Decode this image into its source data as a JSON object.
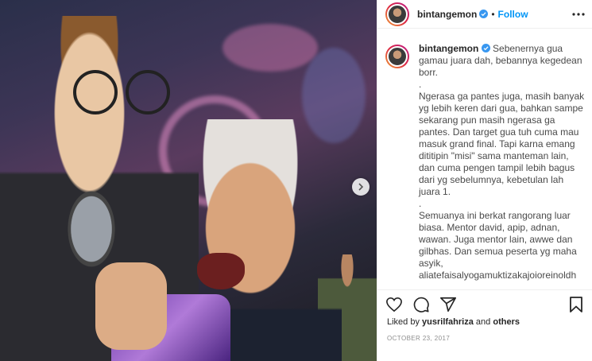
{
  "post": {
    "username": "bintangemon",
    "follow_label": "Follow",
    "separator": "•",
    "caption": "Sebenernya gua gamau juara dah, bebannya kegedean borr.\n.\nNgerasa ga pantes juga, masih banyak yg lebih keren dari gua, bahkan sampe sekarang pun masih ngerasa ga pantes. Dan target gua tuh cuma mau masuk grand final. Tapi karna emang dititipin \"misi\" sama manteman lain, dan cuma pengen tampil lebih bagus dari yg sebelumnya, kebetulan lah juara 1.\n.\nSemuanya ini berkat rangorang luar biasa. Mentor david, apip, adnan, wawan. Juga mentor lain, awwe dan gilbhas. Dan semua peserta yg maha asyik, aliatefaisalyogamuktizakajoioreinoldh",
    "liked_by_prefix": "Liked by",
    "liked_by_user": "yusrilfahriza",
    "liked_by_and": "and",
    "liked_by_suffix": "others",
    "date": "OCTOBER 23, 2017"
  },
  "icons": {
    "verified": "verified-badge-icon",
    "more": "more-options-icon",
    "like": "heart-icon",
    "comment": "comment-icon",
    "share": "share-icon",
    "save": "bookmark-icon",
    "next": "chevron-right-icon"
  },
  "colors": {
    "accent": "#0095f6",
    "text": "#262626",
    "muted": "#8e8e8e",
    "border": "#efefef"
  }
}
